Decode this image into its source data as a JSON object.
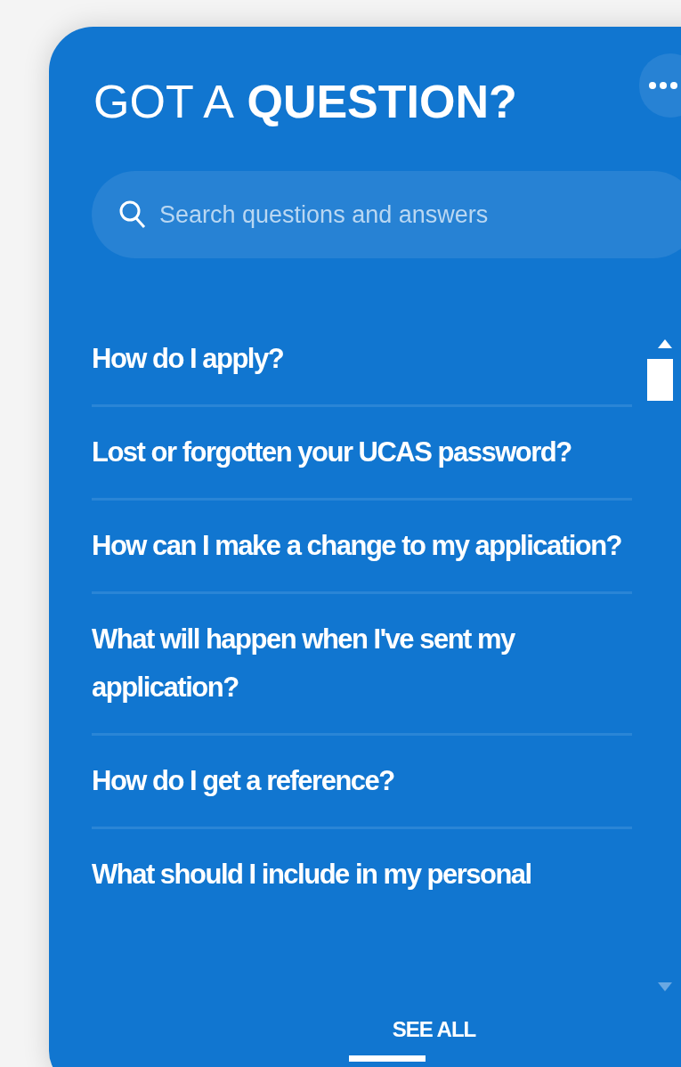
{
  "title": {
    "light": "GOT A",
    "bold": "QUESTION?"
  },
  "search": {
    "placeholder": "Search questions and answers"
  },
  "questions": [
    {
      "text": "How do I apply?"
    },
    {
      "text": "Lost or forgotten your UCAS password?"
    },
    {
      "text": "How can I make a change to my application?"
    },
    {
      "text": "What will happen when I've sent my application?"
    },
    {
      "text": "How do I get a reference?"
    },
    {
      "text": "What should I include in my personal"
    }
  ],
  "see_all": {
    "label": "SEE ALL"
  }
}
